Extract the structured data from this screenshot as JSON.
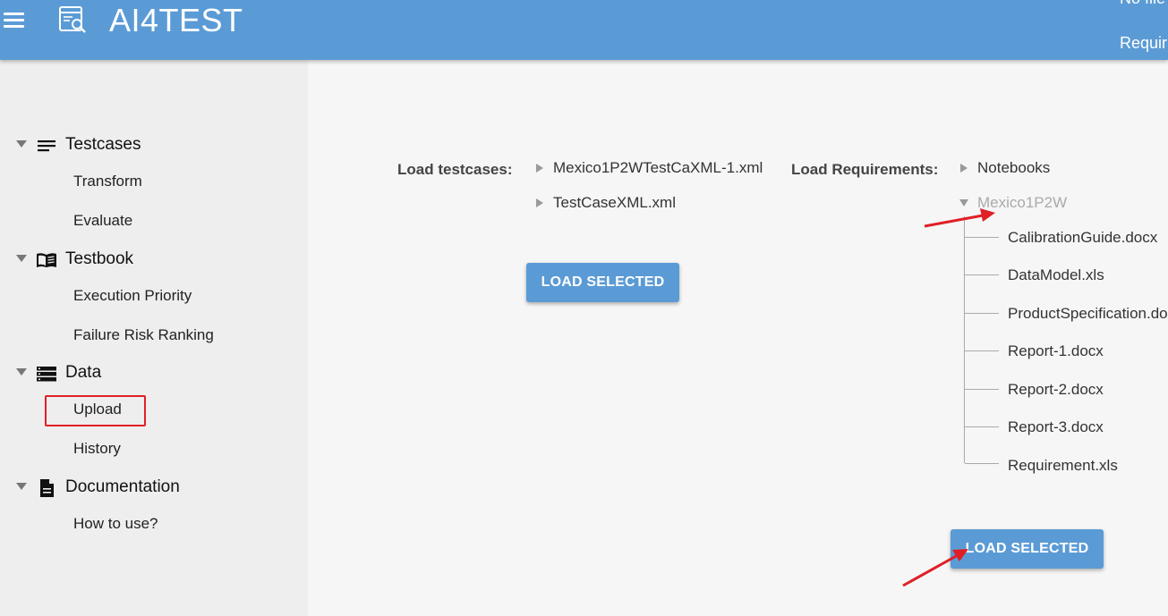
{
  "header": {
    "app_title": "AI4TEST",
    "right_text_1": "No file",
    "right_text_2": "Requir",
    "menu_icon": "hamburger-menu-icon",
    "logo_icon": "document-search-icon"
  },
  "sidebar": {
    "groups": [
      {
        "label": "Testcases",
        "icon": "list-lines-icon",
        "items": [
          "Transform",
          "Evaluate"
        ]
      },
      {
        "label": "Testbook",
        "icon": "open-book-icon",
        "items": [
          "Execution Priority",
          "Failure Risk Ranking"
        ]
      },
      {
        "label": "Data",
        "icon": "storage-icon",
        "items": [
          "Upload",
          "History"
        ]
      },
      {
        "label": "Documentation",
        "icon": "document-icon",
        "items": [
          "How to use?"
        ]
      }
    ]
  },
  "main": {
    "testcases": {
      "label": "Load testcases:",
      "files": [
        "Mexico1P2WTestCaXML-1.xml",
        "TestCaseXML.xml"
      ],
      "button_label": "LOAD SELECTED"
    },
    "requirements": {
      "label": "Load Requirements:",
      "folders": [
        "Notebooks",
        "Mexico1P2W"
      ],
      "files": [
        "CalibrationGuide.docx",
        "DataModel.xls",
        "ProductSpecification.docx",
        "Report-1.docx",
        "Report-2.docx",
        "Report-3.docx",
        "Requirement.xls"
      ],
      "button_label": "LOAD SELECTED"
    }
  },
  "colors": {
    "header": "#5b9bd5",
    "button": "#5b9bd5",
    "annotation": "#e01f26",
    "sidebar": "#eeeeee"
  }
}
